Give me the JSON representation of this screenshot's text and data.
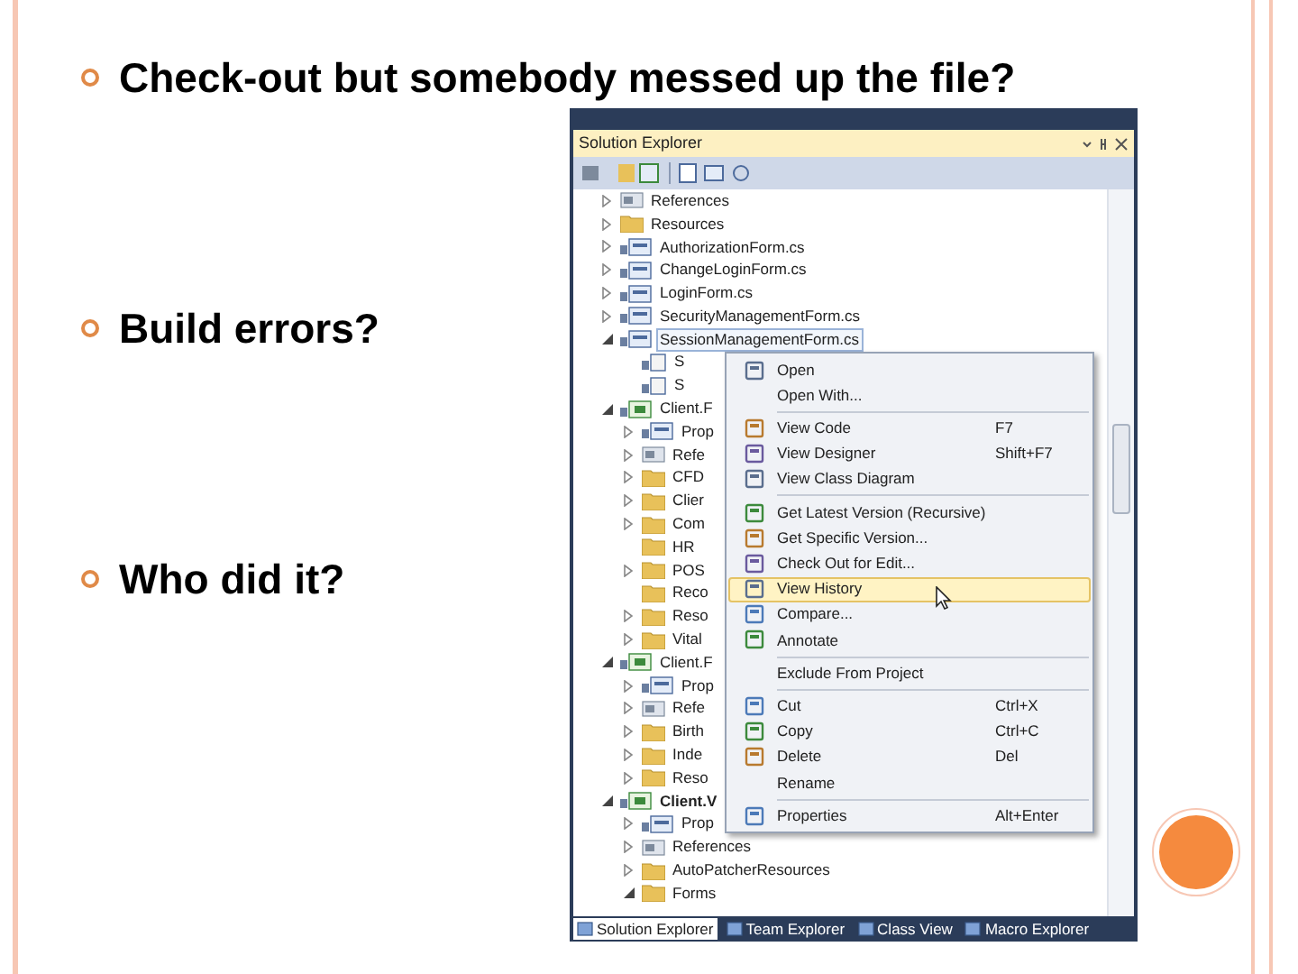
{
  "bullets": [
    "Check-out but somebody messed up the file?",
    "Build errors?",
    "Who did it?"
  ],
  "explorer": {
    "title": "Solution Explorer",
    "tree": [
      {
        "label": "References",
        "kind": "references",
        "expanded": false,
        "selected": false
      },
      {
        "label": "Resources",
        "kind": "folder",
        "expanded": false,
        "selected": false
      },
      {
        "label": "AuthorizationForm.cs",
        "kind": "form",
        "expanded": false,
        "selected": false
      },
      {
        "label": "ChangeLoginForm.cs",
        "kind": "form",
        "expanded": false,
        "selected": false
      },
      {
        "label": "LoginForm.cs",
        "kind": "form",
        "expanded": false,
        "selected": false
      },
      {
        "label": "SecurityManagementForm.cs",
        "kind": "form",
        "expanded": false,
        "selected": false
      },
      {
        "label": "SessionManagementForm.cs",
        "kind": "form",
        "expanded": true,
        "selected": true,
        "children": [
          {
            "label": "S",
            "kind": "file",
            "selected": false
          },
          {
            "label": "S",
            "kind": "file",
            "selected": false
          }
        ]
      },
      {
        "label": "Client.F",
        "kind": "project",
        "expanded": true,
        "selected": false,
        "startup": false,
        "children": [
          {
            "label": "Prop",
            "kind": "properties",
            "expanded": false,
            "selected": false
          },
          {
            "label": "Refe",
            "kind": "references",
            "expanded": false,
            "selected": false
          },
          {
            "label": "CFD",
            "kind": "folder",
            "expanded": false,
            "selected": false
          },
          {
            "label": "Clier",
            "kind": "folder",
            "expanded": false,
            "selected": false
          },
          {
            "label": "Com",
            "kind": "folder",
            "expanded": false,
            "selected": false
          },
          {
            "label": "HR",
            "kind": "folder",
            "selected": false
          },
          {
            "label": "POS",
            "kind": "folder",
            "expanded": false,
            "selected": false
          },
          {
            "label": "Reco",
            "kind": "folder",
            "selected": false
          },
          {
            "label": "Reso",
            "kind": "folder",
            "expanded": false,
            "selected": false
          },
          {
            "label": "Vital",
            "kind": "folder",
            "expanded": false,
            "selected": false
          }
        ]
      },
      {
        "label": "Client.F",
        "kind": "project",
        "expanded": true,
        "selected": false,
        "startup": false,
        "children": [
          {
            "label": "Prop",
            "kind": "properties",
            "expanded": false,
            "selected": false
          },
          {
            "label": "Refe",
            "kind": "references",
            "expanded": false,
            "selected": false
          },
          {
            "label": "Birth",
            "kind": "folder",
            "expanded": false,
            "selected": false
          },
          {
            "label": "Inde",
            "kind": "folder",
            "expanded": false,
            "selected": false
          },
          {
            "label": "Reso",
            "kind": "folder",
            "expanded": false,
            "selected": false
          }
        ]
      },
      {
        "label": "Client.V",
        "kind": "project",
        "expanded": true,
        "selected": false,
        "startup": true,
        "children": [
          {
            "label": "Prop",
            "kind": "properties",
            "expanded": false,
            "selected": false
          },
          {
            "label": "References",
            "kind": "references",
            "expanded": false,
            "selected": false
          },
          {
            "label": "AutoPatcherResources",
            "kind": "folder",
            "expanded": false,
            "selected": false
          },
          {
            "label": "Forms",
            "kind": "folder",
            "expanded": true,
            "selected": false
          }
        ]
      }
    ],
    "menu": [
      {
        "kind": "item",
        "label": "Open",
        "selected": false
      },
      {
        "kind": "item",
        "label": "Open With...",
        "selected": false
      },
      {
        "kind": "separator"
      },
      {
        "kind": "item",
        "label": "View Code",
        "shortcut": "F7",
        "selected": false
      },
      {
        "kind": "item",
        "label": "View Designer",
        "shortcut": "Shift+F7",
        "selected": false
      },
      {
        "kind": "item",
        "label": "View Class Diagram",
        "selected": false
      },
      {
        "kind": "separator"
      },
      {
        "kind": "item",
        "label": "Get Latest Version (Recursive)",
        "selected": false
      },
      {
        "kind": "item",
        "label": "Get Specific Version...",
        "selected": false
      },
      {
        "kind": "item",
        "label": "Check Out for Edit...",
        "selected": false
      },
      {
        "kind": "item",
        "label": "View History",
        "selected": true
      },
      {
        "kind": "item",
        "label": "Compare...",
        "selected": false
      },
      {
        "kind": "item",
        "label": "Annotate",
        "selected": false
      },
      {
        "kind": "separator"
      },
      {
        "kind": "item",
        "label": "Exclude From Project",
        "selected": false
      },
      {
        "kind": "separator"
      },
      {
        "kind": "item",
        "label": "Cut",
        "shortcut": "Ctrl+X",
        "selected": false
      },
      {
        "kind": "item",
        "label": "Copy",
        "shortcut": "Ctrl+C",
        "selected": false
      },
      {
        "kind": "item",
        "label": "Delete",
        "shortcut": "Del",
        "selected": false
      },
      {
        "kind": "item",
        "label": "Rename",
        "selected": false
      },
      {
        "kind": "separator"
      },
      {
        "kind": "item",
        "label": "Properties",
        "shortcut": "Alt+Enter",
        "selected": false
      }
    ],
    "tabs": [
      {
        "label": "Solution Explorer",
        "selected": true
      },
      {
        "label": "Team Explorer",
        "selected": false
      },
      {
        "label": "Class View",
        "selected": false
      },
      {
        "label": "Macro Explorer",
        "selected": false
      }
    ]
  }
}
